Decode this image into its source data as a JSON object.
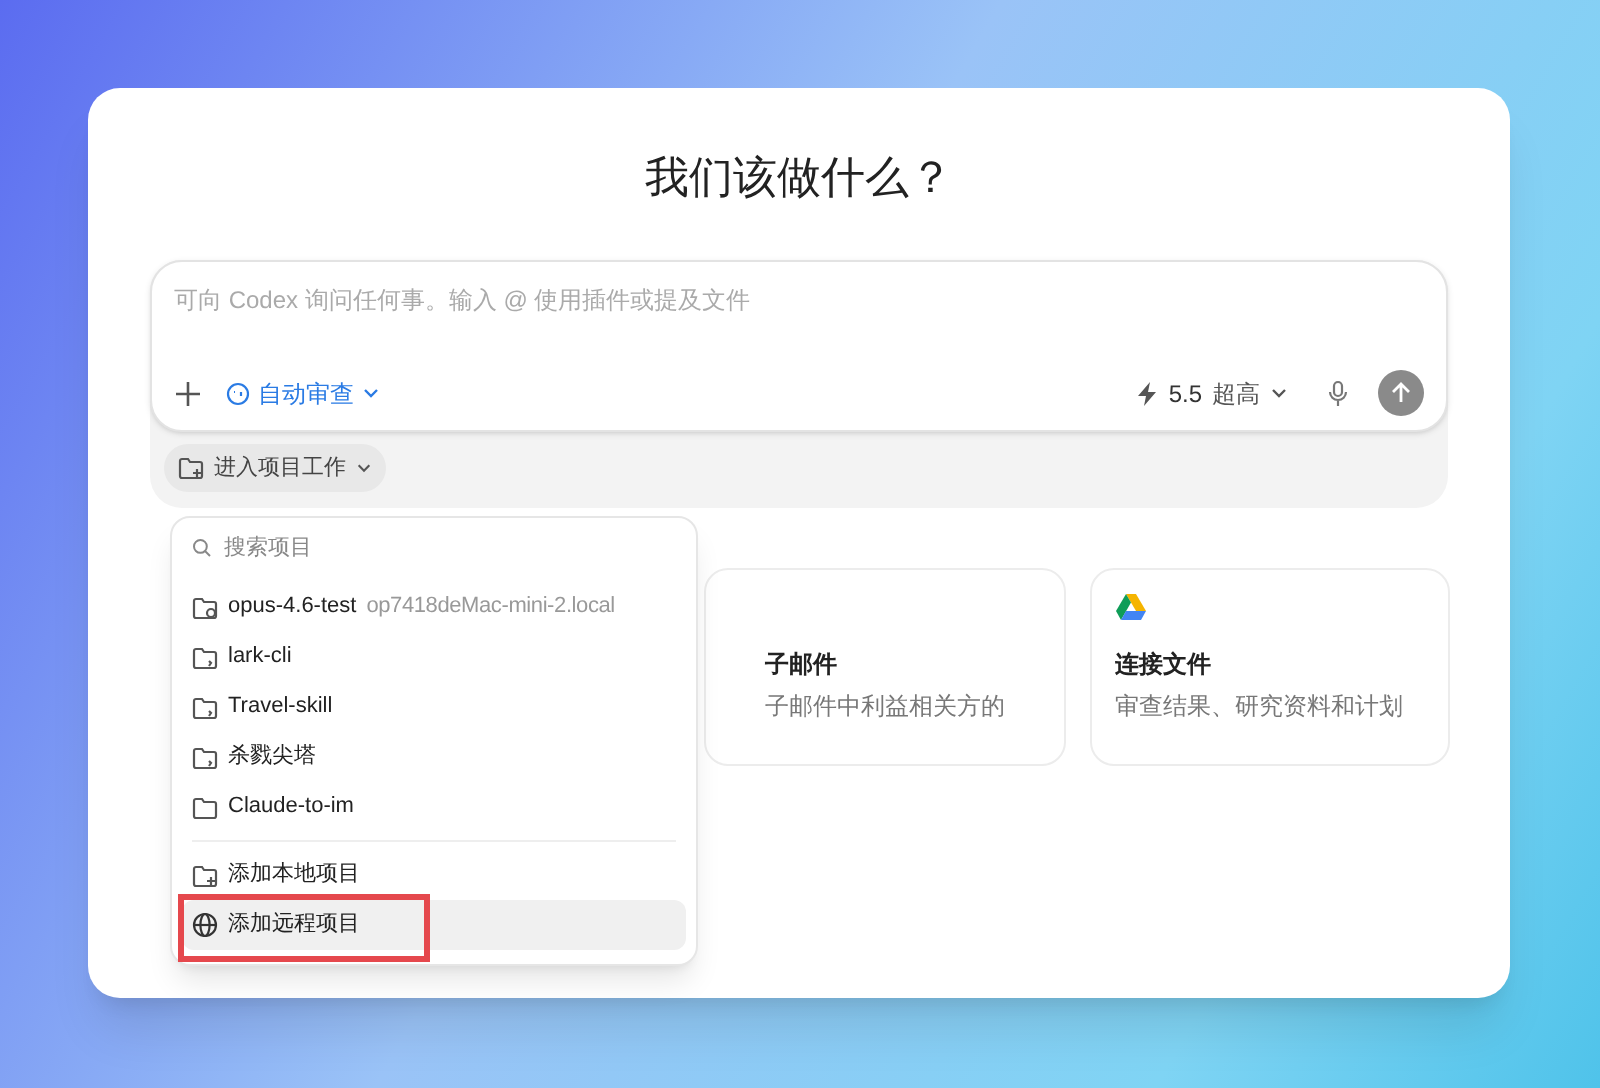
{
  "title": "我们该做什么？",
  "composer": {
    "placeholder": "可向 Codex 询问任何事。输入 @ 使用插件或提及文件",
    "mode": "自动审查",
    "model": "5.5",
    "effort": "超高"
  },
  "project_button": "进入项目工作",
  "cards": [
    {
      "title": "子邮件",
      "description": "子邮件中利益相关方的"
    },
    {
      "title": "连接文件",
      "description": "审查结果、研究资料和计划"
    }
  ],
  "menu": {
    "search_placeholder": "搜索项目",
    "projects": [
      {
        "name": "opus-4.6-test",
        "host": "op7418deMac-mini-2.local",
        "kind": "remote"
      },
      {
        "name": "lark-cli",
        "kind": "local"
      },
      {
        "name": "Travel-skill",
        "kind": "local"
      },
      {
        "name": "杀戮尖塔",
        "kind": "local"
      },
      {
        "name": "Claude-to-im",
        "kind": "plain"
      }
    ],
    "actions": [
      {
        "label": "添加本地项目",
        "kind": "add",
        "selected": false
      },
      {
        "label": "添加远程项目",
        "kind": "globe",
        "selected": true
      }
    ]
  }
}
